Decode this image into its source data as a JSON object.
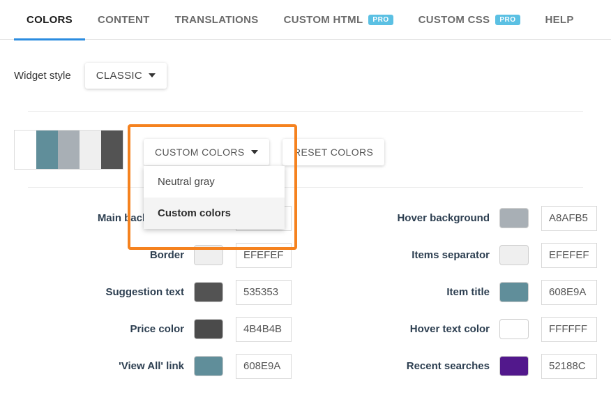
{
  "tabs": [
    {
      "label": "COLORS",
      "active": true,
      "pro": false
    },
    {
      "label": "CONTENT",
      "active": false,
      "pro": false
    },
    {
      "label": "TRANSLATIONS",
      "active": false,
      "pro": false
    },
    {
      "label": "CUSTOM HTML",
      "active": false,
      "pro": true,
      "pro_label": "PRO"
    },
    {
      "label": "CUSTOM CSS",
      "active": false,
      "pro": true,
      "pro_label": "PRO"
    },
    {
      "label": "HELP",
      "active": false,
      "pro": false
    }
  ],
  "widget_style": {
    "label": "Widget style",
    "value": "CLASSIC"
  },
  "palette": {
    "swatches": [
      "#FFFFFF",
      "#608E9A",
      "#A8AFB5",
      "#EFEFEF",
      "#535353"
    ]
  },
  "buttons": {
    "custom_colors": "CUSTOM COLORS",
    "reset_colors": "RESET COLORS"
  },
  "dropdown": {
    "open": true,
    "items": [
      {
        "label": "Neutral gray",
        "selected": false
      },
      {
        "label": "Custom colors",
        "selected": true
      }
    ]
  },
  "highlight": {
    "color": "#F5821F"
  },
  "accent": {
    "active_tab_underline": "#2B8CE0",
    "pro_badge_bg": "#5BC0E3"
  },
  "color_fields": {
    "left": [
      {
        "label": "Main background",
        "value": "",
        "swatch": "#FFFFFF"
      },
      {
        "label": "Border",
        "value": "EFEFEF",
        "swatch": "#EFEFEF"
      },
      {
        "label": "Suggestion text",
        "value": "535353",
        "swatch": "#535353"
      },
      {
        "label": "Price color",
        "value": "4B4B4B",
        "swatch": "#4B4B4B"
      },
      {
        "label": "'View All' link",
        "value": "608E9A",
        "swatch": "#608E9A"
      }
    ],
    "right": [
      {
        "label": "Hover background",
        "value": "A8AFB5",
        "swatch": "#A8AFB5"
      },
      {
        "label": "Items separator",
        "value": "EFEFEF",
        "swatch": "#EFEFEF"
      },
      {
        "label": "Item title",
        "value": "608E9A",
        "swatch": "#608E9A"
      },
      {
        "label": "Hover text color",
        "value": "FFFFFF",
        "swatch": "#FFFFFF"
      },
      {
        "label": "Recent searches",
        "value": "52188C",
        "swatch": "#52188C"
      }
    ]
  }
}
